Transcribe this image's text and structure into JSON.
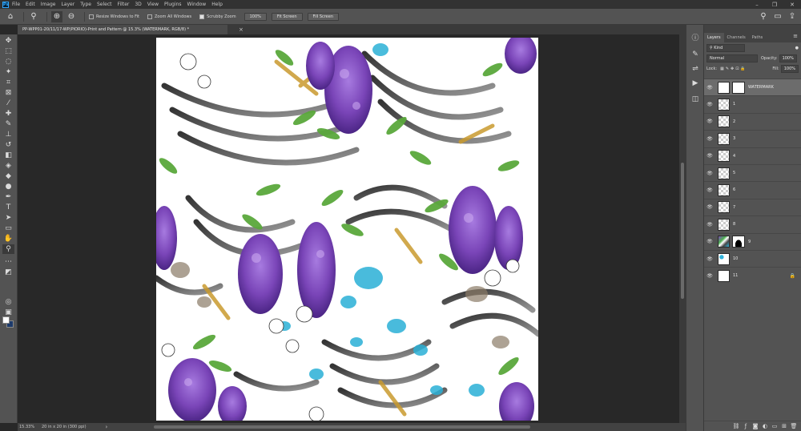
{
  "app": {
    "menus": [
      "File",
      "Edit",
      "Image",
      "Layer",
      "Type",
      "Select",
      "Filter",
      "3D",
      "View",
      "Plugins",
      "Window",
      "Help"
    ]
  },
  "options": {
    "resize_windows": "Resize Windows to Fit",
    "zoom_all": "Zoom All Windows",
    "scrubby_zoom": "Scrubby Zoom",
    "zoom_pct": "100%",
    "fit_screen": "Fit Screen",
    "fill_screen": "Fill Screen"
  },
  "document": {
    "tab_title": "PP-WPP01-20/11/17-WP(PIORIO)-Print and Pattern @ 15.3% (WATERMARK, RGB/8) *",
    "close": "×"
  },
  "status": {
    "zoom": "15.33%",
    "doc_info": "20 in x 20 in (300 ppi)",
    "arrow": "›"
  },
  "layers_panel": {
    "tabs": [
      "Layers",
      "Channels",
      "Paths"
    ],
    "kind_filter": "Kind",
    "blend_mode": "Normal",
    "opacity_label": "Opacity:",
    "opacity_value": "100%",
    "lock_label": "Lock:",
    "fill_label": "Fill:",
    "fill_value": "100%",
    "layers": [
      {
        "name": "WATERMARK",
        "thumb": "white",
        "selected": true
      },
      {
        "name": "1",
        "thumb": "transparent"
      },
      {
        "name": "2",
        "thumb": "transparent"
      },
      {
        "name": "3",
        "thumb": "transparent"
      },
      {
        "name": "4",
        "thumb": "transparent"
      },
      {
        "name": "5",
        "thumb": "transparent"
      },
      {
        "name": "6",
        "thumb": "transparent"
      },
      {
        "name": "7",
        "thumb": "transparent"
      },
      {
        "name": "8",
        "thumb": "transparent"
      },
      {
        "name": "9",
        "thumb": "art"
      },
      {
        "name": "10",
        "thumb": "teal"
      },
      {
        "name": "11",
        "thumb": "white",
        "locked": true
      }
    ]
  },
  "colors": {
    "foreground": "#ffffff",
    "background": "#1d3a6b",
    "accent": "#31a8ff"
  }
}
